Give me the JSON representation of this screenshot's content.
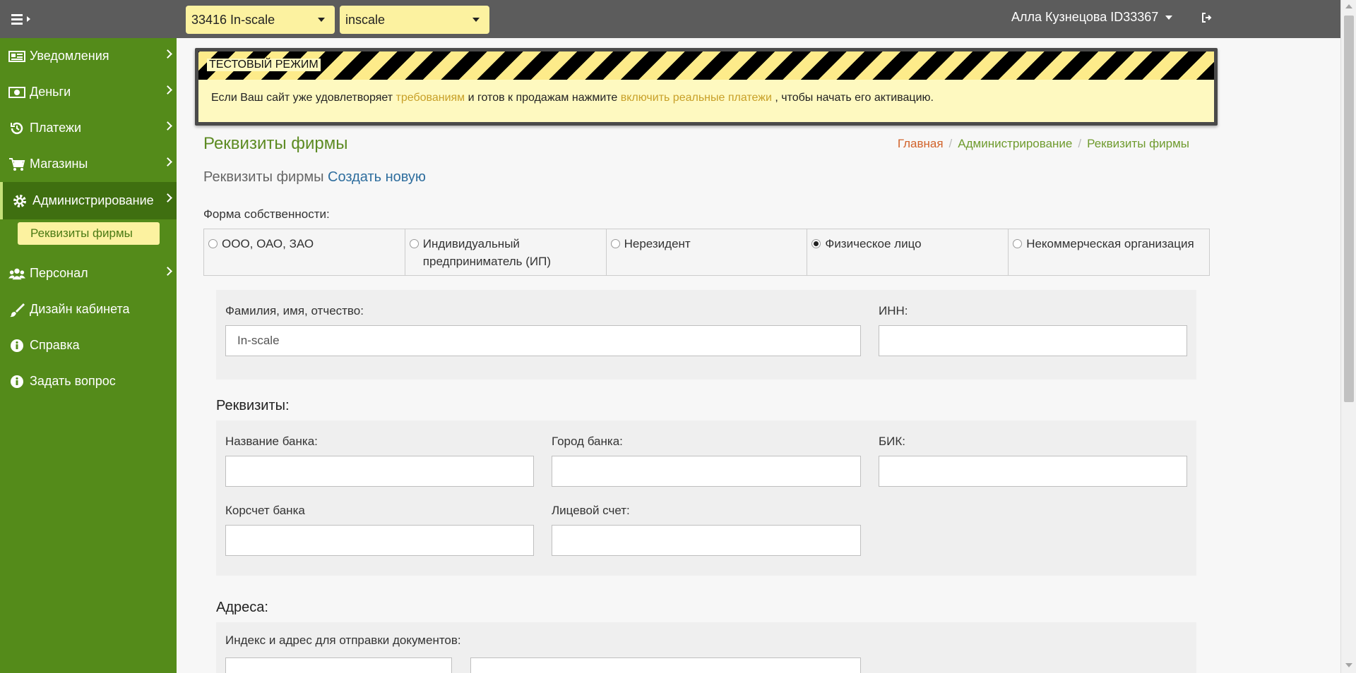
{
  "topbar": {
    "account_select": "33416 In-scale",
    "site_select": "inscale",
    "user_name": "Алла Кузнецова ID33367"
  },
  "sidebar": {
    "items": [
      {
        "label": "Уведомления",
        "icon": "newspaper-icon"
      },
      {
        "label": "Деньги",
        "icon": "money-icon"
      },
      {
        "label": "Платежи",
        "icon": "history-icon"
      },
      {
        "label": "Магазины",
        "icon": "cart-icon"
      },
      {
        "label": "Администрирование",
        "icon": "gear-icon"
      },
      {
        "label": "Персонал",
        "icon": "users-icon"
      },
      {
        "label": "Дизайн кабинета",
        "icon": "brush-icon"
      },
      {
        "label": "Справка",
        "icon": "info-icon"
      },
      {
        "label": "Задать вопрос",
        "icon": "info-icon"
      }
    ],
    "sub_item": "Реквизиты фирмы"
  },
  "banner": {
    "mode_label": "ТЕСТОВЫЙ РЕЖИМ",
    "msg_part1": "Если Ваш сайт уже удовлетворяет ",
    "link1": "требованиям",
    "msg_part2": " и готов к продажам нажмите ",
    "link2": "включить реальные платежи",
    "msg_part3": " , чтобы начать его активацию."
  },
  "page": {
    "title": "Реквизиты фирмы",
    "subheader": "Реквизиты фирмы",
    "create_link": "Создать новую"
  },
  "breadcrumb": {
    "home": "Главная",
    "admin": "Администрирование",
    "current": "Реквизиты фирмы"
  },
  "ownership": {
    "label": "Форма собственности:",
    "options": [
      {
        "label": "ООО, ОАО, ЗАО",
        "checked": false
      },
      {
        "label": "Индивидуальный предприниматель (ИП)",
        "checked": false
      },
      {
        "label": "Нерезидент",
        "checked": false
      },
      {
        "label": "Физическое лицо",
        "checked": true
      },
      {
        "label": "Некоммерческая организация",
        "checked": false
      }
    ]
  },
  "person": {
    "fio_label": "Фамилия, имя, отчество:",
    "fio_value": "In-scale",
    "inn_label": "ИНН:",
    "inn_value": ""
  },
  "requisites": {
    "title": "Реквизиты:",
    "bank_name_label": "Название банка:",
    "bank_city_label": "Город банка:",
    "bik_label": "БИК:",
    "corr_account_label": "Корсчет банка",
    "personal_account_label": "Лицевой счет:"
  },
  "addresses": {
    "title": "Адреса:",
    "postal_label": "Индекс и адрес для отправки документов:"
  }
}
